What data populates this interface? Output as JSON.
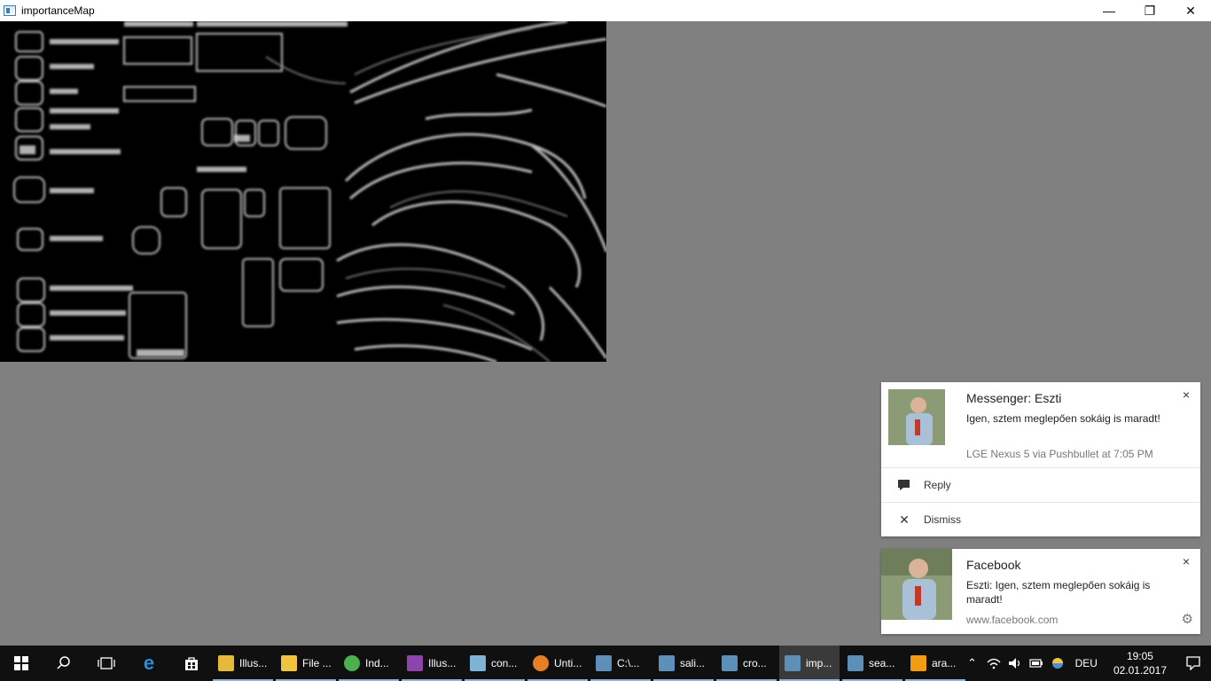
{
  "window": {
    "title": "importanceMap",
    "minimize": "—",
    "restore": "❐",
    "close": "✕"
  },
  "notifications": [
    {
      "title": "Messenger: Eszti",
      "message": "Igen, sztem meglepően sokáig is maradt!",
      "meta": "LGE Nexus 5 via Pushbullet at 7:05 PM",
      "close": "×",
      "actions": [
        {
          "icon": "reply-icon",
          "label": "Reply"
        },
        {
          "icon": "dismiss-icon",
          "label": "Dismiss"
        }
      ]
    },
    {
      "title": "Facebook",
      "message": "Eszti: Igen, sztem meglepően sokáig is maradt!",
      "meta": "www.facebook.com",
      "close": "×"
    }
  ],
  "taskbar": {
    "apps": [
      {
        "label": "Illus...",
        "icon": "folder-icon",
        "color": "#e8b83a"
      },
      {
        "label": "File ...",
        "icon": "file-explorer-icon",
        "color": "#f0c340"
      },
      {
        "label": "Ind...",
        "icon": "chrome-icon",
        "color": "#4caf50"
      },
      {
        "label": "Illus...",
        "icon": "visual-studio-icon",
        "color": "#8e44ad"
      },
      {
        "label": "con...",
        "icon": "notepad-icon",
        "color": "#7fb3d5"
      },
      {
        "label": "Unti...",
        "icon": "paint-icon",
        "color": "#e67e22"
      },
      {
        "label": "C:\\...",
        "icon": "window-icon",
        "color": "#5d8fb8"
      },
      {
        "label": "sali...",
        "icon": "window-icon",
        "color": "#5d8fb8"
      },
      {
        "label": "cro...",
        "icon": "window-icon",
        "color": "#5d8fb8"
      },
      {
        "label": "imp...",
        "icon": "window-icon",
        "color": "#5d8fb8",
        "active": true
      },
      {
        "label": "sea...",
        "icon": "window-icon",
        "color": "#5d8fb8"
      },
      {
        "label": "ara...",
        "icon": "vlc-icon",
        "color": "#f39c12"
      }
    ],
    "language": "DEU",
    "time": "19:05",
    "date": "02.01.2017"
  }
}
